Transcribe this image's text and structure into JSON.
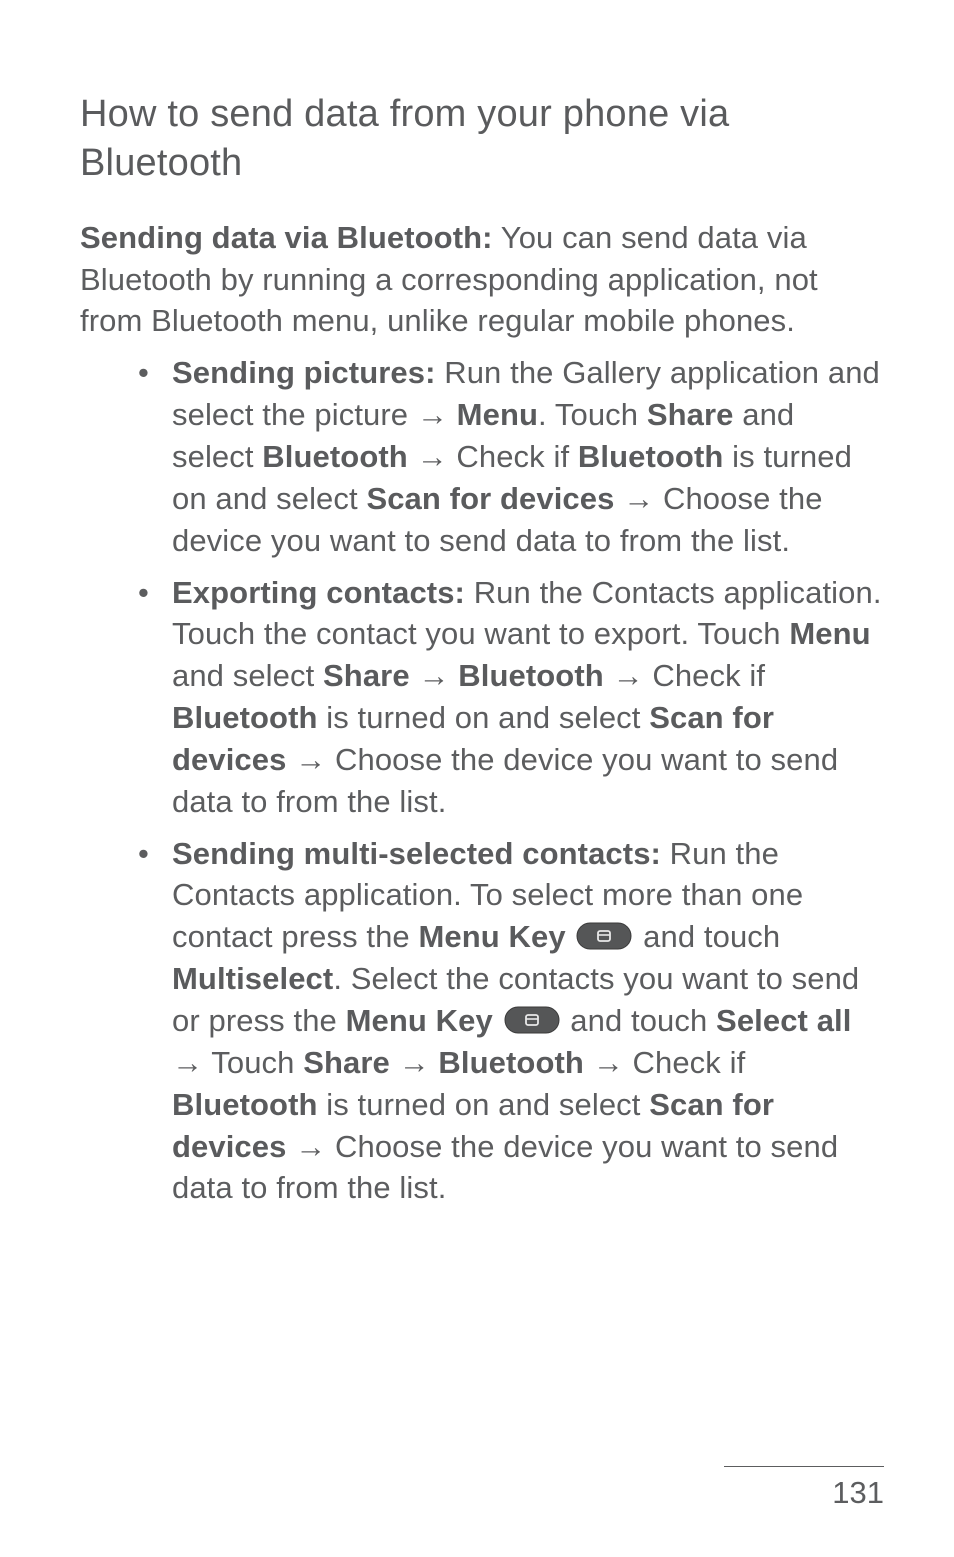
{
  "heading": "How to send data from your phone via Bluetooth",
  "intro": {
    "lead": "Sending data via Bluetooth:",
    "rest": " You can send data via Bluetooth by running a corresponding application, not from Bluetooth menu, unlike regular mobile phones."
  },
  "bullet1": {
    "t1": "Sending pictures:",
    "t2": " Run the Gallery application and select the picture ",
    "arrow1": "→",
    "t3": " Menu",
    "t4": ". Touch ",
    "t5": "Share",
    "t6": " and select ",
    "t7": "Bluetooth",
    "t8": " ",
    "arrow2": "→",
    "t9": " Check if ",
    "t10": "Bluetooth",
    "t11": " is turned on and select ",
    "t12": "Scan for devices",
    "t13": " ",
    "arrow3": "→",
    "t14": " Choose the device you want to send data to from the list."
  },
  "bullet2": {
    "t1": "Exporting contacts:",
    "t2": " Run the Contacts application. Touch the contact you want to export. Touch ",
    "t3": "Menu",
    "t4": " and select ",
    "t5": "Share",
    "t6": " ",
    "arrow1": "→",
    "t7": " ",
    "t8": "Bluetooth",
    "t9": " ",
    "arrow2": "→",
    "t10": " Check if ",
    "t11": "Bluetooth",
    "t12": " is turned on and select ",
    "t13": "Scan for devices",
    "t14": " ",
    "arrow3": "→",
    "t15": " Choose the device you want to send data to from the list."
  },
  "bullet3": {
    "t1": "Sending multi-selected contacts:",
    "t2": " Run the Contacts application. To select more than one contact press the ",
    "t3": "Menu Key",
    "t4": " ",
    "t5": " and touch ",
    "t6": "Multiselect",
    "t7": ". Select the contacts you want to send or press the ",
    "t8": "Menu Key",
    "t9": " ",
    "t10": " and touch ",
    "t11": "Select all",
    "t12": " ",
    "arrow1": "→",
    "t13": " Touch ",
    "t14": "Share",
    "t15": " ",
    "arrow2": "→",
    "t16": " ",
    "t17": "Bluetooth",
    "t18": " ",
    "arrow3": "→",
    "t19": " Check if ",
    "t20": "Bluetooth",
    "t21": " is turned on and select ",
    "t22": "Scan for devices",
    "t23": " ",
    "arrow4": "→",
    "t24": " Choose the device you want to send data to from the list."
  },
  "page_number": "131",
  "icons": {
    "menu_key": "menu-key-icon"
  }
}
